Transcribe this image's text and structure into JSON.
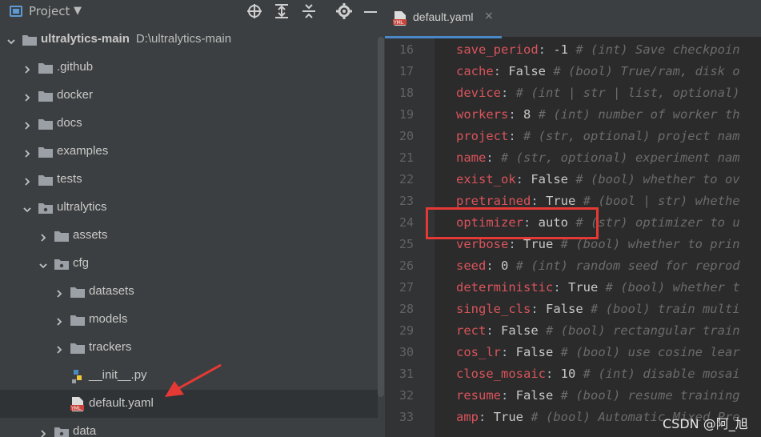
{
  "panel": {
    "title": "Project",
    "toolbar": [
      "locate-icon",
      "expand-all-icon",
      "collapse-all-icon",
      "gear-icon",
      "hide-icon"
    ]
  },
  "tree": [
    {
      "label": "ultralytics-main",
      "path": "D:\\ultralytics-main",
      "expanded": true,
      "depth": 0,
      "bold": true
    },
    {
      "label": ".github",
      "expanded": false,
      "depth": 1
    },
    {
      "label": "docker",
      "expanded": false,
      "depth": 1
    },
    {
      "label": "docs",
      "expanded": false,
      "depth": 1
    },
    {
      "label": "examples",
      "expanded": false,
      "depth": 1
    },
    {
      "label": "tests",
      "expanded": false,
      "depth": 1
    },
    {
      "label": "ultralytics",
      "expanded": true,
      "depth": 1
    },
    {
      "label": "assets",
      "expanded": false,
      "depth": 2
    },
    {
      "label": "cfg",
      "expanded": true,
      "depth": 2
    },
    {
      "label": "datasets",
      "expanded": false,
      "depth": 3
    },
    {
      "label": "models",
      "expanded": false,
      "depth": 3
    },
    {
      "label": "trackers",
      "expanded": false,
      "depth": 3
    },
    {
      "label": "__init__.py",
      "type": "python",
      "depth": 3
    },
    {
      "label": "default.yaml",
      "type": "yaml",
      "depth": 3,
      "selected": true
    },
    {
      "label": "data",
      "expanded": false,
      "depth": 2
    }
  ],
  "editor": {
    "tab_label": "default.yaml",
    "tab_close": "×",
    "yml_badge": "YML",
    "lines": [
      {
        "n": "16",
        "key": "save_period",
        "val": " -1",
        "comment": " # (int) Save checkpoin"
      },
      {
        "n": "17",
        "key": "cache",
        "val": " False",
        "comment": " # (bool) True/ram, disk o"
      },
      {
        "n": "18",
        "key": "device",
        "val": "",
        "comment": " # (int | str | list, optional)"
      },
      {
        "n": "19",
        "key": "workers",
        "val": " 8",
        "comment": " # (int) number of worker th"
      },
      {
        "n": "20",
        "key": "project",
        "val": "",
        "comment": " # (str, optional) project nam"
      },
      {
        "n": "21",
        "key": "name",
        "val": "",
        "comment": " # (str, optional) experiment nam"
      },
      {
        "n": "22",
        "key": "exist_ok",
        "val": " False",
        "comment": " # (bool) whether to ov"
      },
      {
        "n": "23",
        "key": "pretrained",
        "val": " True",
        "comment": " # (bool | str) whethe"
      },
      {
        "n": "24",
        "key": "optimizer",
        "val": " auto",
        "comment": " # (str) optimizer to u"
      },
      {
        "n": "25",
        "key": "verbose",
        "val": " True",
        "comment": " # (bool) whether to prin"
      },
      {
        "n": "26",
        "key": "seed",
        "val": " 0",
        "comment": " # (int) random seed for reprod"
      },
      {
        "n": "27",
        "key": "deterministic",
        "val": " True",
        "comment": " # (bool) whether t"
      },
      {
        "n": "28",
        "key": "single_cls",
        "val": " False",
        "comment": " # (bool) train multi"
      },
      {
        "n": "29",
        "key": "rect",
        "val": " False",
        "comment": " # (bool) rectangular train"
      },
      {
        "n": "30",
        "key": "cos_lr",
        "val": " False",
        "comment": " # (bool) use cosine lear"
      },
      {
        "n": "31",
        "key": "close_mosaic",
        "val": " 10",
        "comment": " # (int) disable mosai"
      },
      {
        "n": "32",
        "key": "resume",
        "val": " False",
        "comment": " # (bool) resume training"
      },
      {
        "n": "33",
        "key": "amp",
        "val": " True",
        "comment": " # (bool) Automatic Mixed Pre"
      }
    ]
  },
  "watermark": "CSDN @阿_旭",
  "colors": {
    "key": "#cc7832",
    "value": "#a9b7c6",
    "comment": "#808080",
    "highlight": "#e53935",
    "accent": "#4a88c7"
  }
}
